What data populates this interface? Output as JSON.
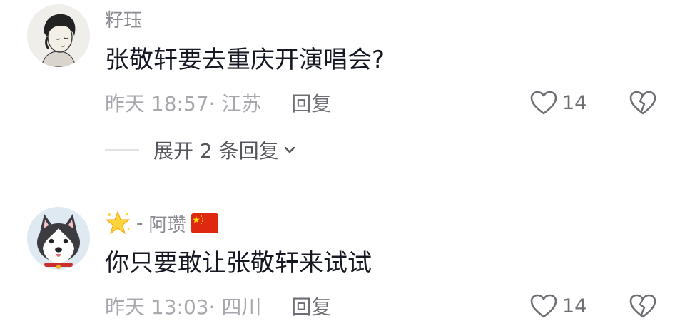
{
  "comments": [
    {
      "username": "籽珏",
      "text": "张敬轩要去重庆开演唱会?",
      "time_location": "昨天 18:57· 江苏",
      "reply_label": "回复",
      "like_count": "14",
      "expand_replies_label": "展开 2 条回复"
    },
    {
      "username_prefix": "-",
      "username": "阿瓒",
      "text": "你只要敢让张敬轩来试试",
      "time_location": "昨天 13:03· 四川",
      "reply_label": "回复",
      "like_count": "14"
    }
  ],
  "icons": {
    "like": "heart-outline-icon",
    "dislike": "broken-heart-icon",
    "expand": "chevron-down-icon",
    "star": "star-emoji-icon",
    "flag": "china-flag-icon"
  },
  "colors": {
    "text_primary": "#161823",
    "text_secondary": "#8a8b91",
    "text_meta": "#a7a8ad",
    "flag_red": "#de2910",
    "flag_yellow": "#ffde00"
  }
}
